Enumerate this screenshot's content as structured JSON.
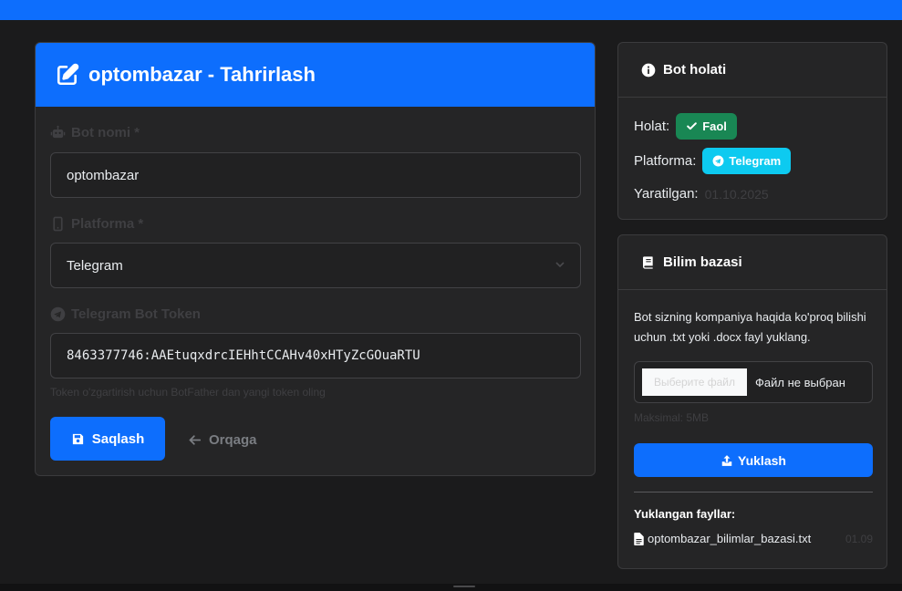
{
  "colors": {
    "primary": "#0d6efd",
    "success": "#198754",
    "info": "#0dcaf0",
    "background": "#1b1b1c",
    "card": "#252526"
  },
  "edit": {
    "title": "optombazar - Tahrirlash",
    "title_icon": "edit-icon",
    "bot_name_label": "Bot nomi *",
    "bot_name_icon": "robot-icon",
    "bot_name_value": "optombazar",
    "platform_label": "Platforma *",
    "platform_icon": "mobile-icon",
    "platform_value": "Telegram",
    "token_label": "Telegram Bot Token",
    "token_icon": "telegram-icon",
    "token_value": "8463377746:AAEtuqxdrcIEHhtCCAHv40xHTyZcGOuaRTU",
    "token_help": "Token o'zgartirish uchun BotFather dan yangi token oling",
    "save_label": "Saqlash",
    "back_label": "Orqaga"
  },
  "status": {
    "title": "Bot holati",
    "state_label": "Holat:",
    "state_value": "Faol",
    "platform_label": "Platforma:",
    "platform_value": "Telegram",
    "created_label": "Yaratilgan:",
    "created_value": "01.10.2025"
  },
  "kb": {
    "title": "Bilim bazasi",
    "description": "Bot sizning kompaniya haqida ko'proq bilishi uchun .txt yoki .docx fayl yuklang.",
    "file_button": "Выберите файл",
    "file_none": "Файл не выбран",
    "max_text": "Maksimal: 5MB",
    "upload_label": "Yuklash",
    "uploaded_title": "Yuklangan fayllar:",
    "files": [
      {
        "name": "optombazar_bilimlar_bazasi.txt",
        "time": "01.09"
      }
    ]
  }
}
